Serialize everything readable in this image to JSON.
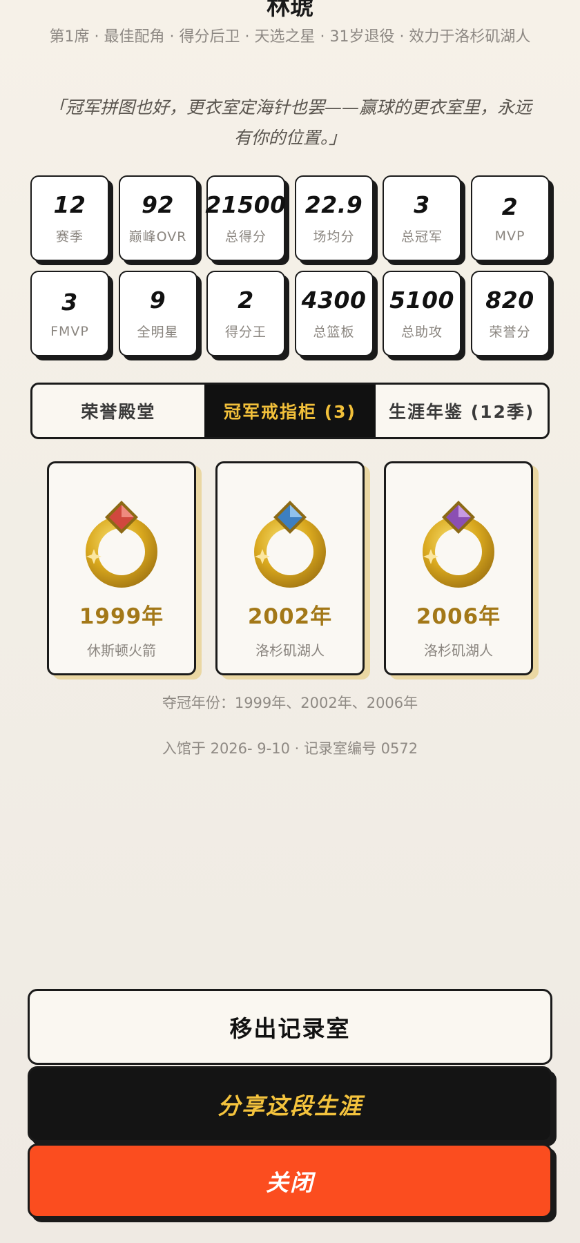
{
  "player": {
    "name": "林琥",
    "subtitle": "第1席 · 最佳配角 · 得分后卫 · 天选之星 · 31岁退役 · 效力于洛杉矶湖人",
    "quote": "「冠军拼图也好，更衣室定海针也罢——赢球的更衣室里，永远有你的位置。」"
  },
  "stats": [
    {
      "value": "12",
      "label": "赛季"
    },
    {
      "value": "92",
      "label": "巅峰OVR"
    },
    {
      "value": "21500",
      "label": "总得分"
    },
    {
      "value": "22.9",
      "label": "场均分"
    },
    {
      "value": "3",
      "label": "总冠军"
    },
    {
      "value": "2",
      "label": "MVP"
    },
    {
      "value": "3",
      "label": "FMVP"
    },
    {
      "value": "9",
      "label": "全明星"
    },
    {
      "value": "2",
      "label": "得分王"
    },
    {
      "value": "4300",
      "label": "总篮板"
    },
    {
      "value": "5100",
      "label": "总助攻"
    },
    {
      "value": "820",
      "label": "荣誉分"
    }
  ],
  "tabs": [
    {
      "label": "荣誉殿堂",
      "active": false
    },
    {
      "label": "冠军戒指柜 (3)",
      "active": true
    },
    {
      "label": "生涯年鉴 (12季)",
      "active": false
    }
  ],
  "rings": [
    {
      "year": "1999年",
      "team": "休斯顿火箭",
      "gem_color": "#d0483e",
      "icon": "championship-ring-icon"
    },
    {
      "year": "2002年",
      "team": "洛杉矶湖人",
      "gem_color": "#3d7fc1",
      "icon": "championship-ring-icon"
    },
    {
      "year": "2006年",
      "team": "洛杉矶湖人",
      "gem_color": "#8b4fb3",
      "icon": "championship-ring-icon"
    }
  ],
  "championship_years": "夺冠年份：1999年、2002年、2006年",
  "induction": "入馆于 2026- 9-10 · 记录室编号 0572",
  "buttons": {
    "remove": "移出记录室",
    "share": "分享这段生涯",
    "close": "关闭"
  },
  "colors": {
    "accent_gold": "#f2c03a",
    "close_orange": "#fb4d1f",
    "dark": "#111111"
  }
}
